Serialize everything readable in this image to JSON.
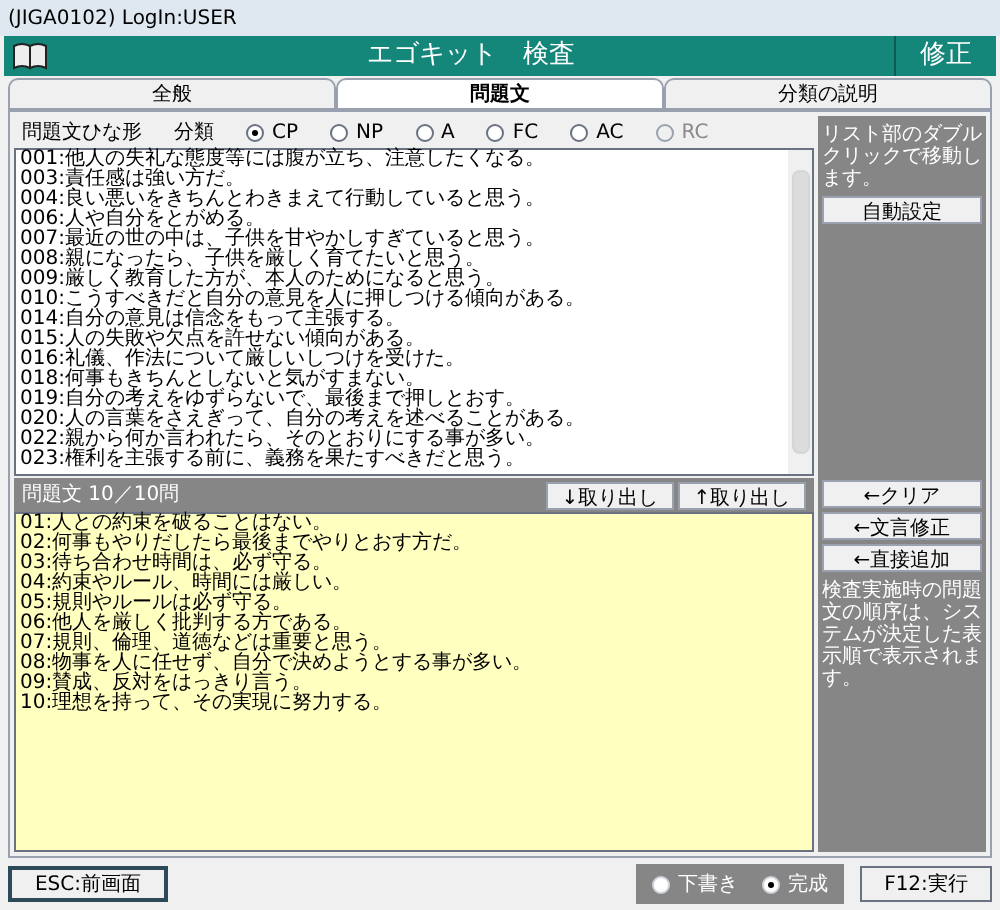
{
  "window": {
    "title": "(JIGA0102)  LogIn:USER"
  },
  "header": {
    "title": "エゴキット　検査",
    "mode": "修正"
  },
  "tabs": [
    {
      "label": "全般",
      "selected": false
    },
    {
      "label": "問題文",
      "selected": true
    },
    {
      "label": "分類の説明",
      "selected": false
    }
  ],
  "template_label": "問題文ひな形",
  "category_label": "分類",
  "categories": [
    {
      "label": "CP",
      "selected": true,
      "disabled": false
    },
    {
      "label": "NP",
      "selected": false,
      "disabled": false
    },
    {
      "label": "A",
      "selected": false,
      "disabled": false
    },
    {
      "label": "FC",
      "selected": false,
      "disabled": false
    },
    {
      "label": "AC",
      "selected": false,
      "disabled": false
    },
    {
      "label": "RC",
      "selected": false,
      "disabled": true
    }
  ],
  "template_list": [
    "001:他人の失礼な態度等には腹が立ち、注意したくなる。",
    "003:責任感は強い方だ。",
    "004:良い悪いをきちんとわきまえて行動していると思う。",
    "006:人や自分をとがめる。",
    "007:最近の世の中は、子供を甘やかしすぎていると思う。",
    "008:親になったら、子供を厳しく育てたいと思う。",
    "009:厳しく教育した方が、本人のためになると思う。",
    "010:こうすべきだと自分の意見を人に押しつける傾向がある。",
    "014:自分の意見は信念をもって主張する。",
    "015:人の失敗や欠点を許せない傾向がある。",
    "016:礼儀、作法について厳しいしつけを受けた。",
    "018:何事もきちんとしないと気がすまない。",
    "019:自分の考えをゆずらないで、最後まで押しとおす。",
    "020:人の言葉をさえぎって、自分の考えを述べることがある。",
    "022:親から何か言われたら、そのとおりにする事が多い。",
    "023:権利を主張する前に、義務を果たすべきだと思う。"
  ],
  "count_label": "問題文 10／10問",
  "move_buttons": [
    "↓取り出し",
    "↑取り出し"
  ],
  "selected_list": [
    "01:人との約束を破ることはない。",
    "02:何事もやりだしたら最後までやりとおす方だ。",
    "03:待ち合わせ時間は、必ず守る。",
    "04:約束やルール、時間には厳しい。",
    "05:規則やルールは必ず守る。",
    "06:他人を厳しく批判する方である。",
    "07:規則、倫理、道徳などは重要と思う。",
    "08:物事を人に任せず、自分で決めようとする事が多い。",
    "09:賛成、反対をはっきり言う。",
    "10:理想を持って、その実現に努力する。"
  ],
  "side_panel": {
    "hint": "リスト部のダブルクリックで移動します。",
    "auto_button": "自動設定",
    "buttons": [
      "←クリア",
      "←文言修正",
      "←直接追加"
    ],
    "note": "検査実施時の問題文の順序は、システムが決定した表示順で表示されます。"
  },
  "footer": {
    "back_button": "ESC:前画面",
    "status": [
      {
        "label": "下書き",
        "selected": false
      },
      {
        "label": "完成",
        "selected": true
      }
    ],
    "run_button": "F12:実行"
  }
}
